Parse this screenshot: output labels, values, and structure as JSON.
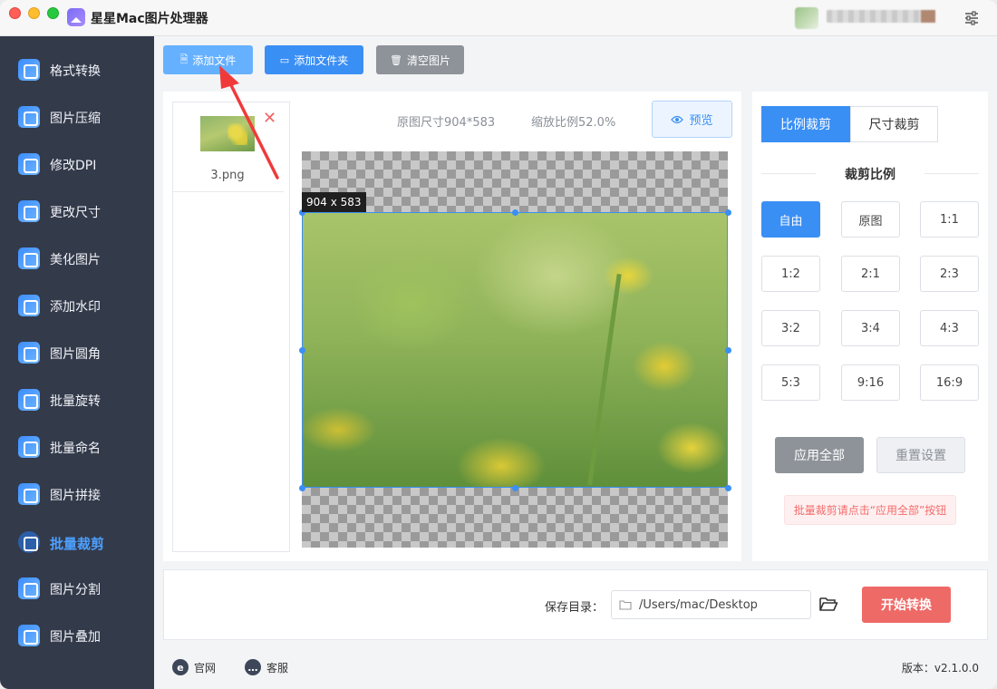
{
  "window": {
    "title": "星星Mac图片处理器"
  },
  "sidebar": {
    "items": [
      {
        "label": "格式转换",
        "icon": "format-convert-icon"
      },
      {
        "label": "图片压缩",
        "icon": "compress-icon"
      },
      {
        "label": "修改DPI",
        "icon": "dpi-icon"
      },
      {
        "label": "更改尺寸",
        "icon": "resize-icon"
      },
      {
        "label": "美化图片",
        "icon": "beautify-icon"
      },
      {
        "label": "添加水印",
        "icon": "watermark-icon"
      },
      {
        "label": "图片圆角",
        "icon": "round-corner-icon"
      },
      {
        "label": "批量旋转",
        "icon": "rotate-icon"
      },
      {
        "label": "批量命名",
        "icon": "rename-icon"
      },
      {
        "label": "图片拼接",
        "icon": "stitch-icon"
      },
      {
        "label": "批量裁剪",
        "icon": "crop-icon",
        "active": true
      },
      {
        "label": "图片分割",
        "icon": "split-icon"
      },
      {
        "label": "图片叠加",
        "icon": "overlay-icon"
      }
    ]
  },
  "toolbar": {
    "add_file": "添加文件",
    "add_folder": "添加文件夹",
    "clear": "清空图片"
  },
  "file_list": {
    "items": [
      {
        "name": "3.png"
      }
    ]
  },
  "preview": {
    "original_size": "原图尺寸904*583",
    "scale": "缩放比例52.0%",
    "preview_button": "预览",
    "dimension_tag": "904 x 583"
  },
  "crop_panel": {
    "tabs": [
      {
        "label": "比例裁剪",
        "active": true
      },
      {
        "label": "尺寸裁剪",
        "active": false
      }
    ],
    "section_title": "裁剪比例",
    "ratios": [
      "自由",
      "原图",
      "1:1",
      "1:2",
      "2:1",
      "2:3",
      "3:2",
      "3:4",
      "4:3",
      "5:3",
      "9:16",
      "16:9"
    ],
    "selected_ratio": "自由",
    "apply_all": "应用全部",
    "reset": "重置设置",
    "hint": "批量裁剪请点击“应用全部”按钮"
  },
  "save": {
    "label": "保存目录：",
    "path": "/Users/mac/Desktop",
    "start_button": "开始转换"
  },
  "footer": {
    "website": "官网",
    "support": "客服",
    "version": "版本：v2.1.0.0"
  },
  "colors": {
    "accent": "#3a8ff5",
    "sidebar_bg": "#333a4a",
    "start_button": "#ee6a67",
    "hint_text": "#f56c6c"
  }
}
